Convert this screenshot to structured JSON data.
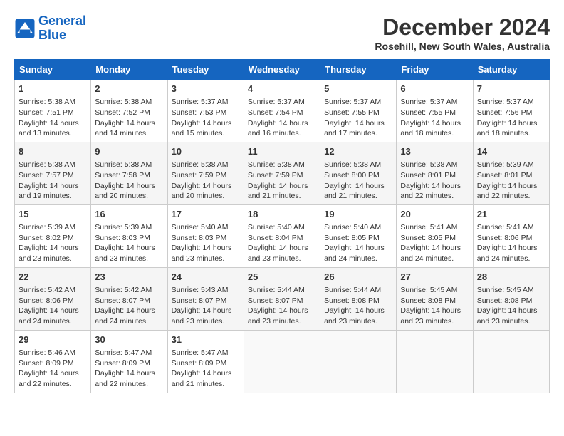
{
  "header": {
    "logo_line1": "General",
    "logo_line2": "Blue",
    "month_title": "December 2024",
    "location": "Rosehill, New South Wales, Australia"
  },
  "weekdays": [
    "Sunday",
    "Monday",
    "Tuesday",
    "Wednesday",
    "Thursday",
    "Friday",
    "Saturday"
  ],
  "weeks": [
    [
      {
        "day": "1",
        "lines": [
          "Sunrise: 5:38 AM",
          "Sunset: 7:51 PM",
          "Daylight: 14 hours",
          "and 13 minutes."
        ]
      },
      {
        "day": "2",
        "lines": [
          "Sunrise: 5:38 AM",
          "Sunset: 7:52 PM",
          "Daylight: 14 hours",
          "and 14 minutes."
        ]
      },
      {
        "day": "3",
        "lines": [
          "Sunrise: 5:37 AM",
          "Sunset: 7:53 PM",
          "Daylight: 14 hours",
          "and 15 minutes."
        ]
      },
      {
        "day": "4",
        "lines": [
          "Sunrise: 5:37 AM",
          "Sunset: 7:54 PM",
          "Daylight: 14 hours",
          "and 16 minutes."
        ]
      },
      {
        "day": "5",
        "lines": [
          "Sunrise: 5:37 AM",
          "Sunset: 7:55 PM",
          "Daylight: 14 hours",
          "and 17 minutes."
        ]
      },
      {
        "day": "6",
        "lines": [
          "Sunrise: 5:37 AM",
          "Sunset: 7:55 PM",
          "Daylight: 14 hours",
          "and 18 minutes."
        ]
      },
      {
        "day": "7",
        "lines": [
          "Sunrise: 5:37 AM",
          "Sunset: 7:56 PM",
          "Daylight: 14 hours",
          "and 18 minutes."
        ]
      }
    ],
    [
      {
        "day": "8",
        "lines": [
          "Sunrise: 5:38 AM",
          "Sunset: 7:57 PM",
          "Daylight: 14 hours",
          "and 19 minutes."
        ]
      },
      {
        "day": "9",
        "lines": [
          "Sunrise: 5:38 AM",
          "Sunset: 7:58 PM",
          "Daylight: 14 hours",
          "and 20 minutes."
        ]
      },
      {
        "day": "10",
        "lines": [
          "Sunrise: 5:38 AM",
          "Sunset: 7:59 PM",
          "Daylight: 14 hours",
          "and 20 minutes."
        ]
      },
      {
        "day": "11",
        "lines": [
          "Sunrise: 5:38 AM",
          "Sunset: 7:59 PM",
          "Daylight: 14 hours",
          "and 21 minutes."
        ]
      },
      {
        "day": "12",
        "lines": [
          "Sunrise: 5:38 AM",
          "Sunset: 8:00 PM",
          "Daylight: 14 hours",
          "and 21 minutes."
        ]
      },
      {
        "day": "13",
        "lines": [
          "Sunrise: 5:38 AM",
          "Sunset: 8:01 PM",
          "Daylight: 14 hours",
          "and 22 minutes."
        ]
      },
      {
        "day": "14",
        "lines": [
          "Sunrise: 5:39 AM",
          "Sunset: 8:01 PM",
          "Daylight: 14 hours",
          "and 22 minutes."
        ]
      }
    ],
    [
      {
        "day": "15",
        "lines": [
          "Sunrise: 5:39 AM",
          "Sunset: 8:02 PM",
          "Daylight: 14 hours",
          "and 23 minutes."
        ]
      },
      {
        "day": "16",
        "lines": [
          "Sunrise: 5:39 AM",
          "Sunset: 8:03 PM",
          "Daylight: 14 hours",
          "and 23 minutes."
        ]
      },
      {
        "day": "17",
        "lines": [
          "Sunrise: 5:40 AM",
          "Sunset: 8:03 PM",
          "Daylight: 14 hours",
          "and 23 minutes."
        ]
      },
      {
        "day": "18",
        "lines": [
          "Sunrise: 5:40 AM",
          "Sunset: 8:04 PM",
          "Daylight: 14 hours",
          "and 23 minutes."
        ]
      },
      {
        "day": "19",
        "lines": [
          "Sunrise: 5:40 AM",
          "Sunset: 8:05 PM",
          "Daylight: 14 hours",
          "and 24 minutes."
        ]
      },
      {
        "day": "20",
        "lines": [
          "Sunrise: 5:41 AM",
          "Sunset: 8:05 PM",
          "Daylight: 14 hours",
          "and 24 minutes."
        ]
      },
      {
        "day": "21",
        "lines": [
          "Sunrise: 5:41 AM",
          "Sunset: 8:06 PM",
          "Daylight: 14 hours",
          "and 24 minutes."
        ]
      }
    ],
    [
      {
        "day": "22",
        "lines": [
          "Sunrise: 5:42 AM",
          "Sunset: 8:06 PM",
          "Daylight: 14 hours",
          "and 24 minutes."
        ]
      },
      {
        "day": "23",
        "lines": [
          "Sunrise: 5:42 AM",
          "Sunset: 8:07 PM",
          "Daylight: 14 hours",
          "and 24 minutes."
        ]
      },
      {
        "day": "24",
        "lines": [
          "Sunrise: 5:43 AM",
          "Sunset: 8:07 PM",
          "Daylight: 14 hours",
          "and 23 minutes."
        ]
      },
      {
        "day": "25",
        "lines": [
          "Sunrise: 5:44 AM",
          "Sunset: 8:07 PM",
          "Daylight: 14 hours",
          "and 23 minutes."
        ]
      },
      {
        "day": "26",
        "lines": [
          "Sunrise: 5:44 AM",
          "Sunset: 8:08 PM",
          "Daylight: 14 hours",
          "and 23 minutes."
        ]
      },
      {
        "day": "27",
        "lines": [
          "Sunrise: 5:45 AM",
          "Sunset: 8:08 PM",
          "Daylight: 14 hours",
          "and 23 minutes."
        ]
      },
      {
        "day": "28",
        "lines": [
          "Sunrise: 5:45 AM",
          "Sunset: 8:08 PM",
          "Daylight: 14 hours",
          "and 23 minutes."
        ]
      }
    ],
    [
      {
        "day": "29",
        "lines": [
          "Sunrise: 5:46 AM",
          "Sunset: 8:09 PM",
          "Daylight: 14 hours",
          "and 22 minutes."
        ]
      },
      {
        "day": "30",
        "lines": [
          "Sunrise: 5:47 AM",
          "Sunset: 8:09 PM",
          "Daylight: 14 hours",
          "and 22 minutes."
        ]
      },
      {
        "day": "31",
        "lines": [
          "Sunrise: 5:47 AM",
          "Sunset: 8:09 PM",
          "Daylight: 14 hours",
          "and 21 minutes."
        ]
      },
      null,
      null,
      null,
      null
    ]
  ]
}
